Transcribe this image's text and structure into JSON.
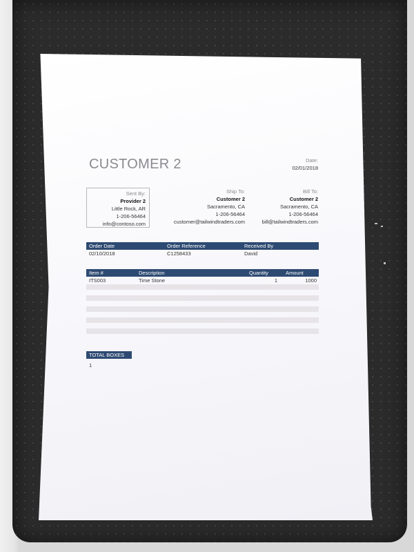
{
  "document": {
    "title": "CUSTOMER 2",
    "date_label": "Date:",
    "date_value": "02/01/2018"
  },
  "sent_by": {
    "label": "Sent By:",
    "name": "Provider 2",
    "city": "Little Rock, AR",
    "phone": "1-206-56464",
    "email": "info@contoso.com"
  },
  "ship_to": {
    "label": "Ship To:",
    "name": "Customer 2",
    "city": "Sacramento, CA",
    "phone": "1-206-56464",
    "email": "customer@tailwindtraders.com"
  },
  "bill_to": {
    "label": "Bill To:",
    "name": "Customer 2",
    "city": "Sacramento, CA",
    "phone": "1-206-56464",
    "email": "bill@tailwindtraders.com"
  },
  "order_table": {
    "headers": [
      "Order Date",
      "Order Reference",
      "Received By"
    ],
    "row": [
      "02/10/2018",
      "C1258433",
      "David"
    ]
  },
  "items_table": {
    "headers": [
      "Item #",
      "Description",
      "Quantity",
      "Amount"
    ],
    "rows": [
      [
        "ITS003",
        "Time Stone",
        "1",
        "1000"
      ]
    ]
  },
  "totals": {
    "label": "TOTAL BOXES",
    "value": "1"
  }
}
